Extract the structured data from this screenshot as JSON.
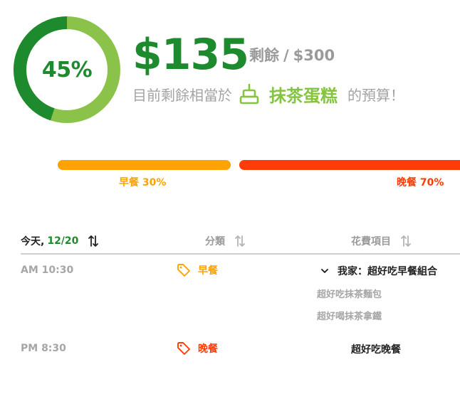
{
  "budget": {
    "percent_label": "45%",
    "percent_value": 45,
    "amount": "$135",
    "remaining_label": "剩餘",
    "separator": "/",
    "total": "$300",
    "compare_prefix": "目前剩餘相當於",
    "compare_icon": "cake-icon",
    "compare_item": "抹茶蛋糕",
    "compare_suffix": "的預算！"
  },
  "split": {
    "breakfast_label": "早餐 30%",
    "breakfast_share": 30,
    "dinner_label": "晚餐 70%",
    "dinner_share": 70
  },
  "table": {
    "date_prefix": "今天,",
    "date_value": "12/20",
    "category_header": "分類",
    "item_header": "花費項目",
    "rows": [
      {
        "time": "AM 10:30",
        "category": "早餐",
        "item": "我家：超好吃早餐組合",
        "sub_items": [
          "超好吃抹茶麵包",
          "超好喝抹茶拿鐵"
        ]
      },
      {
        "time": "PM 8:30",
        "category": "晚餐",
        "item": "超好吃晚餐"
      }
    ]
  },
  "colors": {
    "primary_green": "#1d8a2e",
    "light_green": "#85c441",
    "breakfast_orange": "#ffa206",
    "dinner_red": "#ff3b07",
    "muted_gray": "#a6a6a6"
  }
}
